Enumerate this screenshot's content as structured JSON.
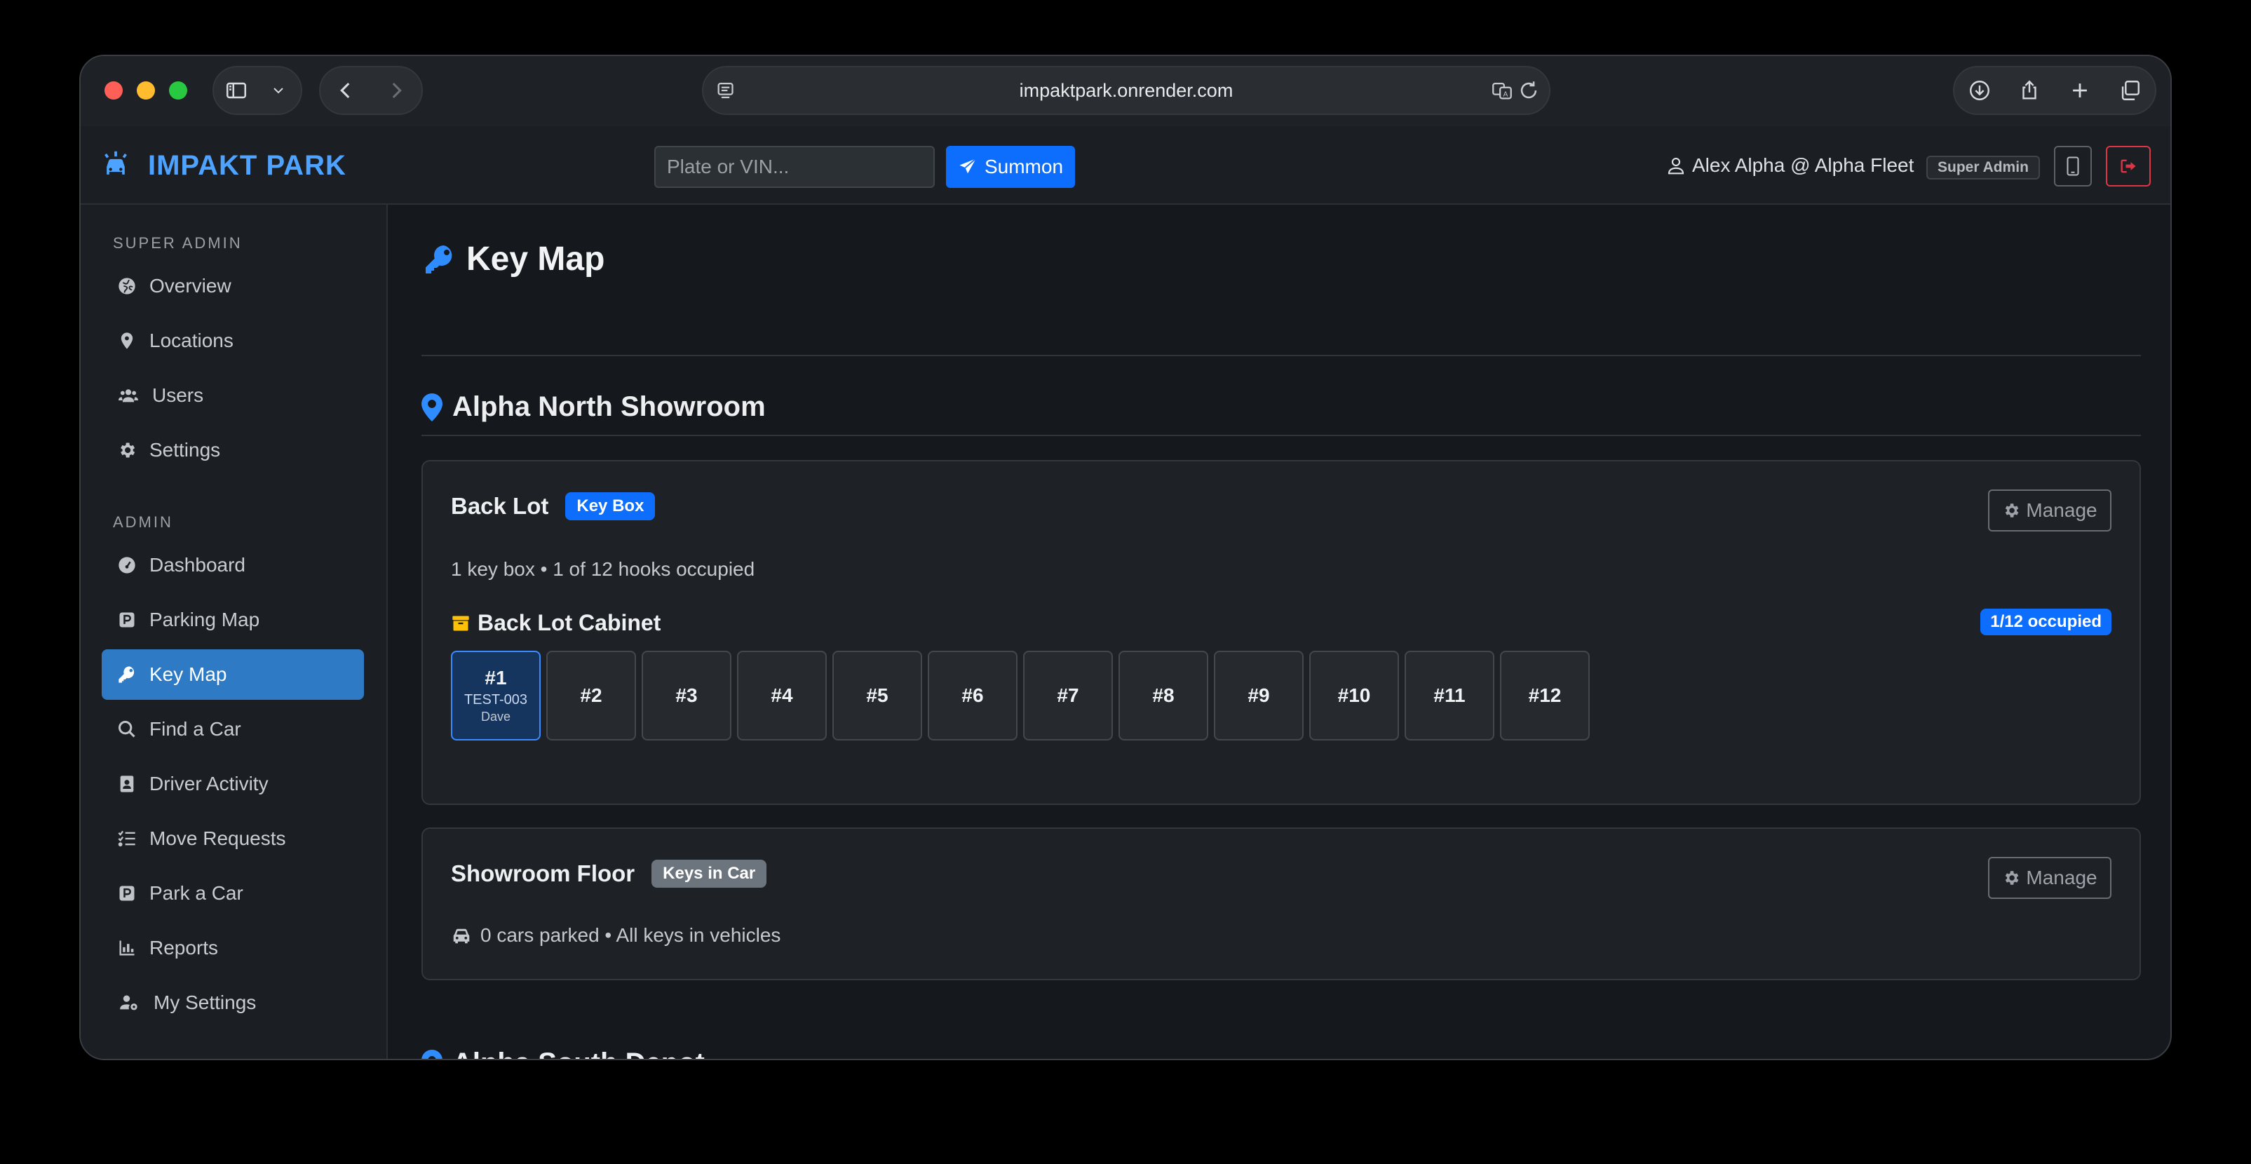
{
  "browser": {
    "url": "impaktpark.onrender.com"
  },
  "navbar": {
    "brand": "IMPAKT PARK",
    "search_placeholder": "Plate or VIN...",
    "summon_label": "Summon",
    "user_label": "Alex Alpha @ Alpha Fleet",
    "role_badge": "Super Admin"
  },
  "sidebar": {
    "super_admin_heading": "SUPER ADMIN",
    "super_admin_items": [
      {
        "label": "Overview",
        "icon": "globe-icon"
      },
      {
        "label": "Locations",
        "icon": "map-pin-icon"
      },
      {
        "label": "Users",
        "icon": "users-icon"
      },
      {
        "label": "Settings",
        "icon": "gear-icon"
      }
    ],
    "admin_heading": "ADMIN",
    "admin_items": [
      {
        "label": "Dashboard",
        "icon": "gauge-icon"
      },
      {
        "label": "Parking Map",
        "icon": "parking-icon"
      },
      {
        "label": "Key Map",
        "icon": "key-icon",
        "active": true
      },
      {
        "label": "Find a Car",
        "icon": "search-icon"
      },
      {
        "label": "Driver Activity",
        "icon": "id-badge-icon"
      },
      {
        "label": "Move Requests",
        "icon": "list-check-icon"
      },
      {
        "label": "Park a Car",
        "icon": "parking-icon"
      },
      {
        "label": "Reports",
        "icon": "chart-icon"
      },
      {
        "label": "My Settings",
        "icon": "user-gear-icon"
      }
    ]
  },
  "main": {
    "page_title": "Key Map",
    "locations": [
      {
        "name": "Alpha North Showroom",
        "zones": [
          {
            "name": "Back Lot",
            "badge": "Key Box",
            "manage_label": "Manage",
            "summary": "1 key box • 1 of 12 hooks occupied",
            "cabinet": {
              "name": "Back Lot Cabinet",
              "occupancy": "1/12 occupied",
              "hooks": [
                {
                  "label": "#1",
                  "plate": "TEST-003",
                  "driver": "Dave",
                  "occupied": true
                },
                {
                  "label": "#2"
                },
                {
                  "label": "#3"
                },
                {
                  "label": "#4"
                },
                {
                  "label": "#5"
                },
                {
                  "label": "#6"
                },
                {
                  "label": "#7"
                },
                {
                  "label": "#8"
                },
                {
                  "label": "#9"
                },
                {
                  "label": "#10"
                },
                {
                  "label": "#11"
                },
                {
                  "label": "#12"
                }
              ]
            }
          },
          {
            "name": "Showroom Floor",
            "badge": "Keys in Car",
            "manage_label": "Manage",
            "summary": "0 cars parked • All keys in vehicles"
          }
        ]
      },
      {
        "name": "Alpha South Depot"
      }
    ]
  },
  "colors": {
    "accent": "#0d6efd",
    "brand": "#4da3ff",
    "active_nav": "#2f7ac4",
    "danger": "#dc3545",
    "cabinet_icon": "#ffc107"
  }
}
